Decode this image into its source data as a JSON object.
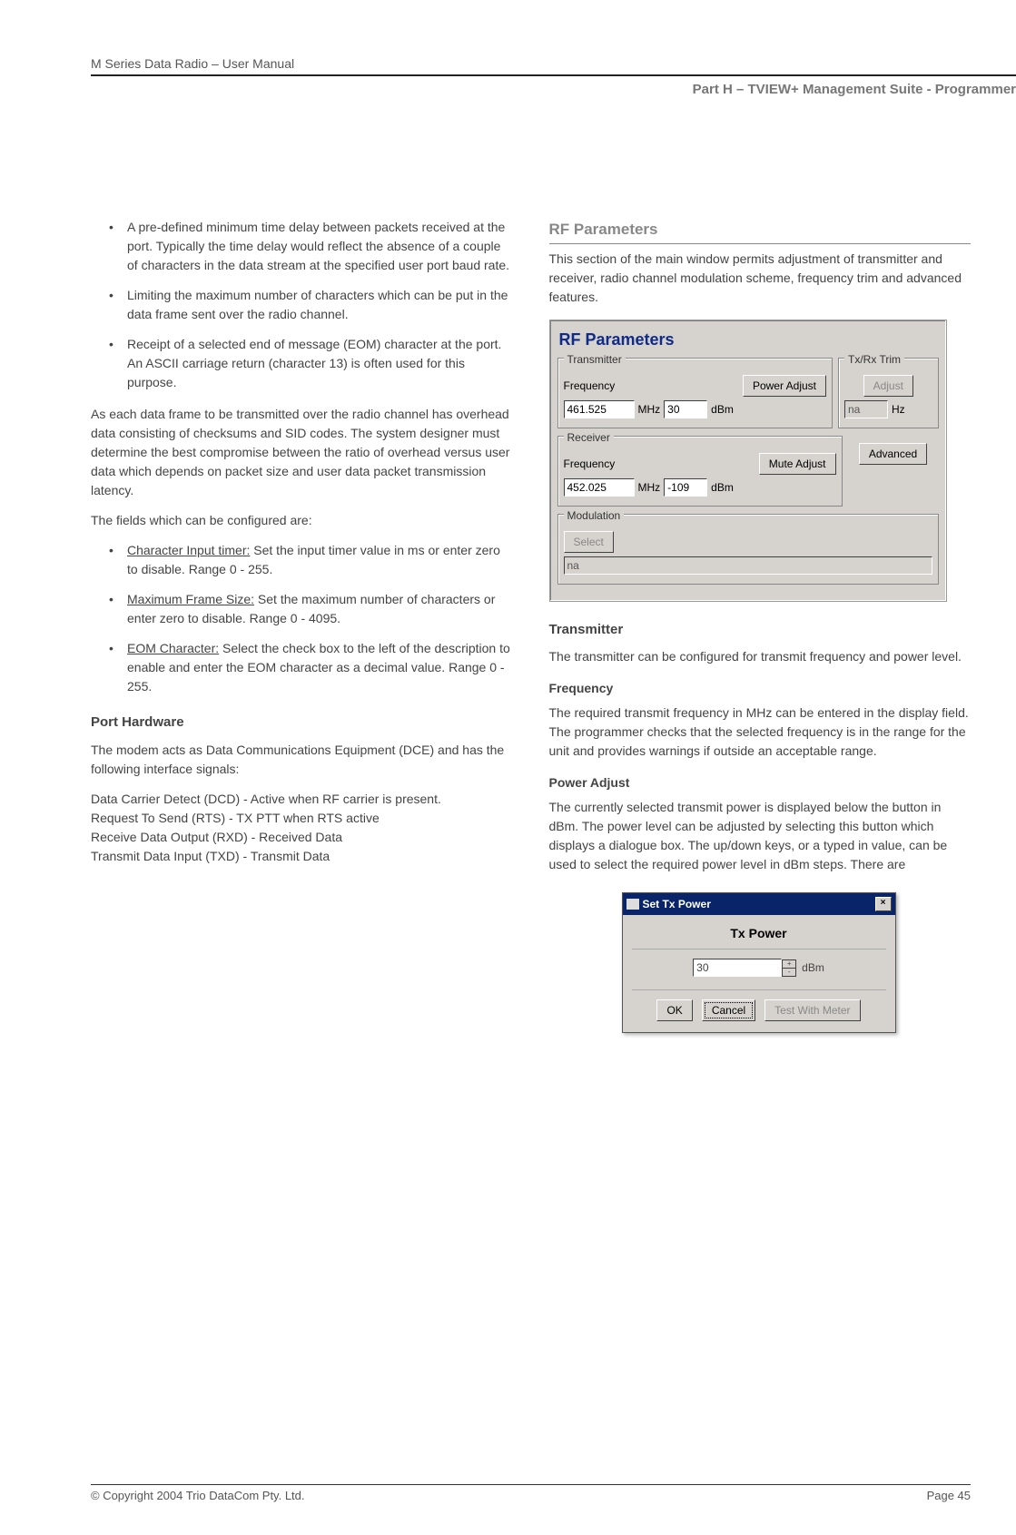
{
  "header": {
    "running_title": "M Series Data Radio – User Manual",
    "section_label": "Part H – TVIEW+ Management Suite - Programmer"
  },
  "left_col": {
    "bullets1": [
      "A pre-defined minimum time delay between packets received at the port. Typically the time delay would reflect the absence of a couple of characters in the data stream at the specified user port baud rate.",
      "Limiting the maximum number of characters which can be put in the data frame sent over the radio channel.",
      "Receipt of a selected end of message (EOM) character at the port. An ASCII carriage return (character 13) is often used for this purpose."
    ],
    "para1": "As each data frame to be transmitted over the radio channel has overhead data consisting of checksums and SID codes.  The system designer must determine the best compromise between the ratio of overhead versus user data which depends on packet size and user data packet transmission latency.",
    "para2": "The fields which can be configured are:",
    "defs": [
      {
        "term": "Character Input timer:",
        "body": " Set the input timer value in ms or enter zero to disable.  Range 0 - 255."
      },
      {
        "term": "Maximum Frame Size:",
        "body": " Set the maximum number of characters or enter zero to disable.  Range 0 - 4095."
      },
      {
        "term": "EOM Character:",
        "body": " Select the check box to the left of the description to enable and enter the EOM character as a decimal value.  Range 0 - 255."
      }
    ],
    "port_hw_heading": "Port Hardware",
    "port_hw_p1": "The modem acts as Data Communications Equipment (DCE) and has the following interface signals:",
    "port_hw_lines": [
      "Data Carrier Detect (DCD) - Active when RF carrier is present.",
      "Request To Send (RTS) - TX PTT when RTS active",
      "Receive Data Output (RXD) - Received Data",
      "Transmit Data Input (TXD) - Transmit Data"
    ]
  },
  "right_col": {
    "rf_heading": "RF Parameters",
    "rf_intro": "This section of the main window permits adjustment of transmitter and receiver, radio channel modulation scheme, frequency trim and advanced features.",
    "panel": {
      "title": "RF Parameters",
      "tx": {
        "legend": "Transmitter",
        "freq_label": "Frequency",
        "freq_value": "461.525",
        "unit": "MHz",
        "power_btn": "Power Adjust",
        "power_value": "30",
        "power_unit": "dBm"
      },
      "trim": {
        "legend": "Tx/Rx Trim",
        "adjust_btn": "Adjust",
        "value": "na",
        "unit": "Hz"
      },
      "rx": {
        "legend": "Receiver",
        "freq_label": "Frequency",
        "freq_value": "452.025",
        "unit": "MHz",
        "mute_btn": "Mute Adjust",
        "mute_value": "-109",
        "mute_unit": "dBm",
        "advanced_btn": "Advanced"
      },
      "mod": {
        "legend": "Modulation",
        "select_btn": "Select",
        "value": "na"
      }
    },
    "tx_heading": "Transmitter",
    "tx_p1": "The transmitter can be configured for transmit frequency and power level.",
    "freq_heading": "Frequency",
    "freq_p": "The required transmit frequency in MHz can be entered in the display field.  The programmer checks that the selected frequency is in the range for the unit and provides warnings if outside an acceptable range.",
    "pa_heading": "Power Adjust",
    "pa_p": "The currently selected transmit power is displayed below the button in dBm. The power level can be adjusted by selecting this button which displays a dialogue box. The up/down keys, or a typed in value, can be used to select the required power level in dBm steps. There are",
    "dialog": {
      "title": "Set Tx Power",
      "body_head": "Tx Power",
      "value": "30",
      "unit": "dBm",
      "ok": "OK",
      "cancel": "Cancel",
      "test": "Test With Meter"
    }
  },
  "footer": {
    "copyright": "© Copyright 2004 Trio DataCom Pty. Ltd.",
    "page": "Page 45"
  }
}
